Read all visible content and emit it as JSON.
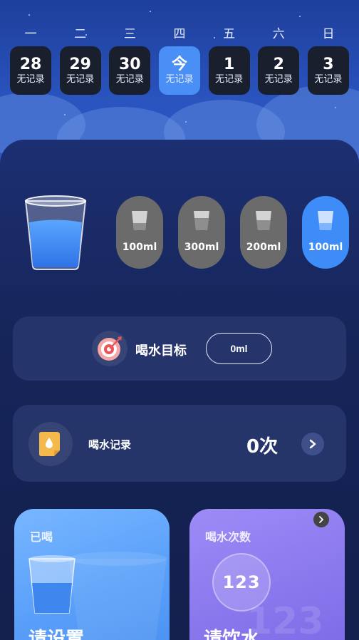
{
  "week": {
    "labels": [
      "一",
      "二",
      "三",
      "四",
      "五",
      "六",
      "日"
    ],
    "days": [
      {
        "num": "28",
        "status": "无记录",
        "today": false
      },
      {
        "num": "29",
        "status": "无记录",
        "today": false
      },
      {
        "num": "30",
        "status": "无记录",
        "today": false
      },
      {
        "num": "今",
        "status": "无记录",
        "today": true
      },
      {
        "num": "1",
        "status": "无记录",
        "today": false
      },
      {
        "num": "2",
        "status": "无记录",
        "today": false
      },
      {
        "num": "3",
        "status": "无记录",
        "today": false
      }
    ]
  },
  "cups": [
    {
      "label": "100ml",
      "active": false,
      "fill": 0.3
    },
    {
      "label": "300ml",
      "active": false,
      "fill": 0.55
    },
    {
      "label": "200ml",
      "active": false,
      "fill": 0.45
    },
    {
      "label": "100ml",
      "active": true,
      "fill": 0.3
    }
  ],
  "goal": {
    "title": "喝水目标",
    "value": "0ml"
  },
  "record": {
    "title": "喝水记录",
    "count": "0次"
  },
  "tiles": {
    "drunk": {
      "title": "已喝",
      "big": "请设置"
    },
    "count": {
      "title": "喝水次数",
      "number": "123",
      "big": "请饮水"
    }
  },
  "colors": {
    "accent": "#3d8cf7",
    "today": "#4a8ff5",
    "cup_inactive": "#6b6b6b"
  }
}
